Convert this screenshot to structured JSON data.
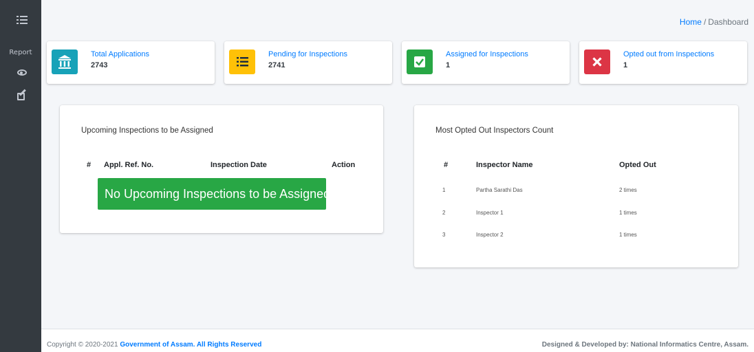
{
  "sidebar": {
    "menu_icon": "list-icon",
    "report_label": "Report",
    "items": [
      {
        "icon": "eye-icon"
      },
      {
        "icon": "edit-icon"
      }
    ]
  },
  "breadcrumb": {
    "home": "Home",
    "separator": "/",
    "current": "Dashboard"
  },
  "infoboxes": [
    {
      "label": "Total Applications",
      "value": "2743",
      "icon": "bank-icon",
      "color": "#17a2b8"
    },
    {
      "label": "Pending for Inspections",
      "value": "2741",
      "icon": "list-icon",
      "color": "#ffc107"
    },
    {
      "label": "Assigned for Inspections",
      "value": "1",
      "icon": "check-square-icon",
      "color": "#28a745"
    },
    {
      "label": "Opted out from Inspections",
      "value": "1",
      "icon": "close-icon",
      "color": "#dc3545"
    }
  ],
  "upcoming": {
    "title": "Upcoming Inspections to be Assigned",
    "columns": [
      "#",
      "Appl. Ref. No.",
      "Inspection Date",
      "Action"
    ],
    "empty_message": "No Upcoming Inspections to be Assigned"
  },
  "opted_out": {
    "title": "Most Opted Out Inspectors Count",
    "columns": [
      "#",
      "Inspector Name",
      "Opted Out"
    ],
    "rows": [
      {
        "num": "1",
        "name": "Partha Sarathi Das",
        "count": "2 times"
      },
      {
        "num": "2",
        "name": "Inspector 1",
        "count": "1 times"
      },
      {
        "num": "3",
        "name": "Inspector 2",
        "count": "1 times"
      }
    ]
  },
  "footer": {
    "copyright_prefix": "Copyright © 2020-2021 ",
    "org": "Government of Assam. All Rights Reserved",
    "credit": "Designed & Developed by: National Informatics Centre, Assam."
  }
}
